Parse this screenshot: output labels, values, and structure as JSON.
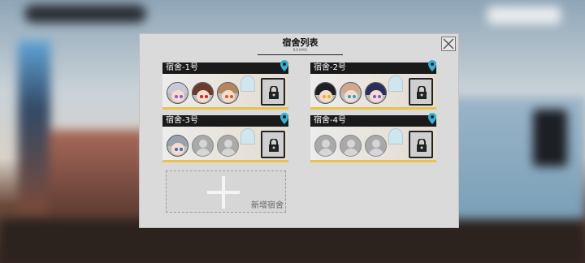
{
  "panel": {
    "title": "宿舍列表",
    "subtitle": "ROOMS",
    "close_icon": "close-icon"
  },
  "rooms": [
    {
      "name": "宿舍-1号",
      "occupants": [
        "char-a",
        "char-b",
        "char-c"
      ]
    },
    {
      "name": "宿舍-2号",
      "occupants": [
        "char-d",
        "char-e",
        "char-f"
      ]
    },
    {
      "name": "宿舍-3号",
      "occupants": [
        "char-g",
        "empty",
        "empty"
      ]
    },
    {
      "name": "宿舍-4号",
      "occupants": [
        "empty",
        "empty",
        "empty"
      ]
    }
  ],
  "add_room": {
    "label": "新增宿舍"
  },
  "colors": {
    "accent_bar": "#e8c24a",
    "pin": "#33b3d9",
    "header": "#1a1a1a"
  }
}
